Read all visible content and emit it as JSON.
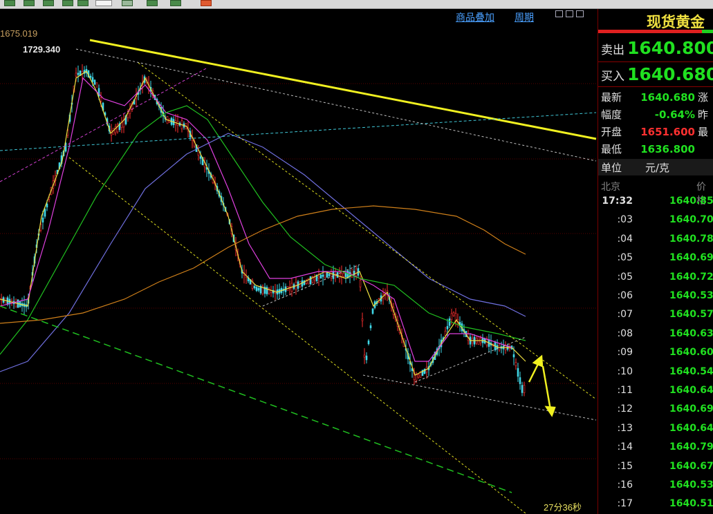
{
  "header": {
    "overlay_link": "商品叠加",
    "period_link": "周期"
  },
  "chart": {
    "ref_price": "1675.019",
    "high_label": "1729.340",
    "countdown": "27分36秒"
  },
  "quote": {
    "title": "现货黄金",
    "sell_label": "卖出",
    "sell_value": "1640.800",
    "buy_label": "买入",
    "buy_value": "1640.680",
    "stats": [
      {
        "label": "最新",
        "value": "1640.680",
        "color": "#20e020",
        "extra": "涨"
      },
      {
        "label": "幅度",
        "value": "-0.64%",
        "color": "#20e020",
        "extra": "昨"
      },
      {
        "label": "开盘",
        "value": "1651.600",
        "color": "#ff3030",
        "extra": "最"
      },
      {
        "label": "最低",
        "value": "1636.800",
        "color": "#20e020",
        "extra": ""
      }
    ],
    "unit_label": "单位",
    "unit_value": "元/克",
    "ticks_location": "北京",
    "ticks_price_header": "价格",
    "ticks": [
      {
        "time": "17:32",
        "price": "1640.85"
      },
      {
        "time": ":03",
        "price": "1640.70"
      },
      {
        "time": ":04",
        "price": "1640.78"
      },
      {
        "time": ":05",
        "price": "1640.69"
      },
      {
        "time": ":05",
        "price": "1640.72"
      },
      {
        "time": ":06",
        "price": "1640.53"
      },
      {
        "time": ":07",
        "price": "1640.57"
      },
      {
        "time": ":08",
        "price": "1640.63"
      },
      {
        "time": ":09",
        "price": "1640.60"
      },
      {
        "time": ":10",
        "price": "1640.54"
      },
      {
        "time": ":11",
        "price": "1640.64"
      },
      {
        "time": ":12",
        "price": "1640.69"
      },
      {
        "time": ":13",
        "price": "1640.64"
      },
      {
        "time": ":14",
        "price": "1640.79"
      },
      {
        "time": ":15",
        "price": "1640.67"
      },
      {
        "time": ":16",
        "price": "1640.53"
      },
      {
        "time": ":17",
        "price": "1640.51"
      }
    ]
  },
  "colors": {
    "up": "#20e020",
    "down": "#ff3030",
    "cyan_candle": "#40d8e8",
    "accent_yellow": "#f0e040"
  }
}
